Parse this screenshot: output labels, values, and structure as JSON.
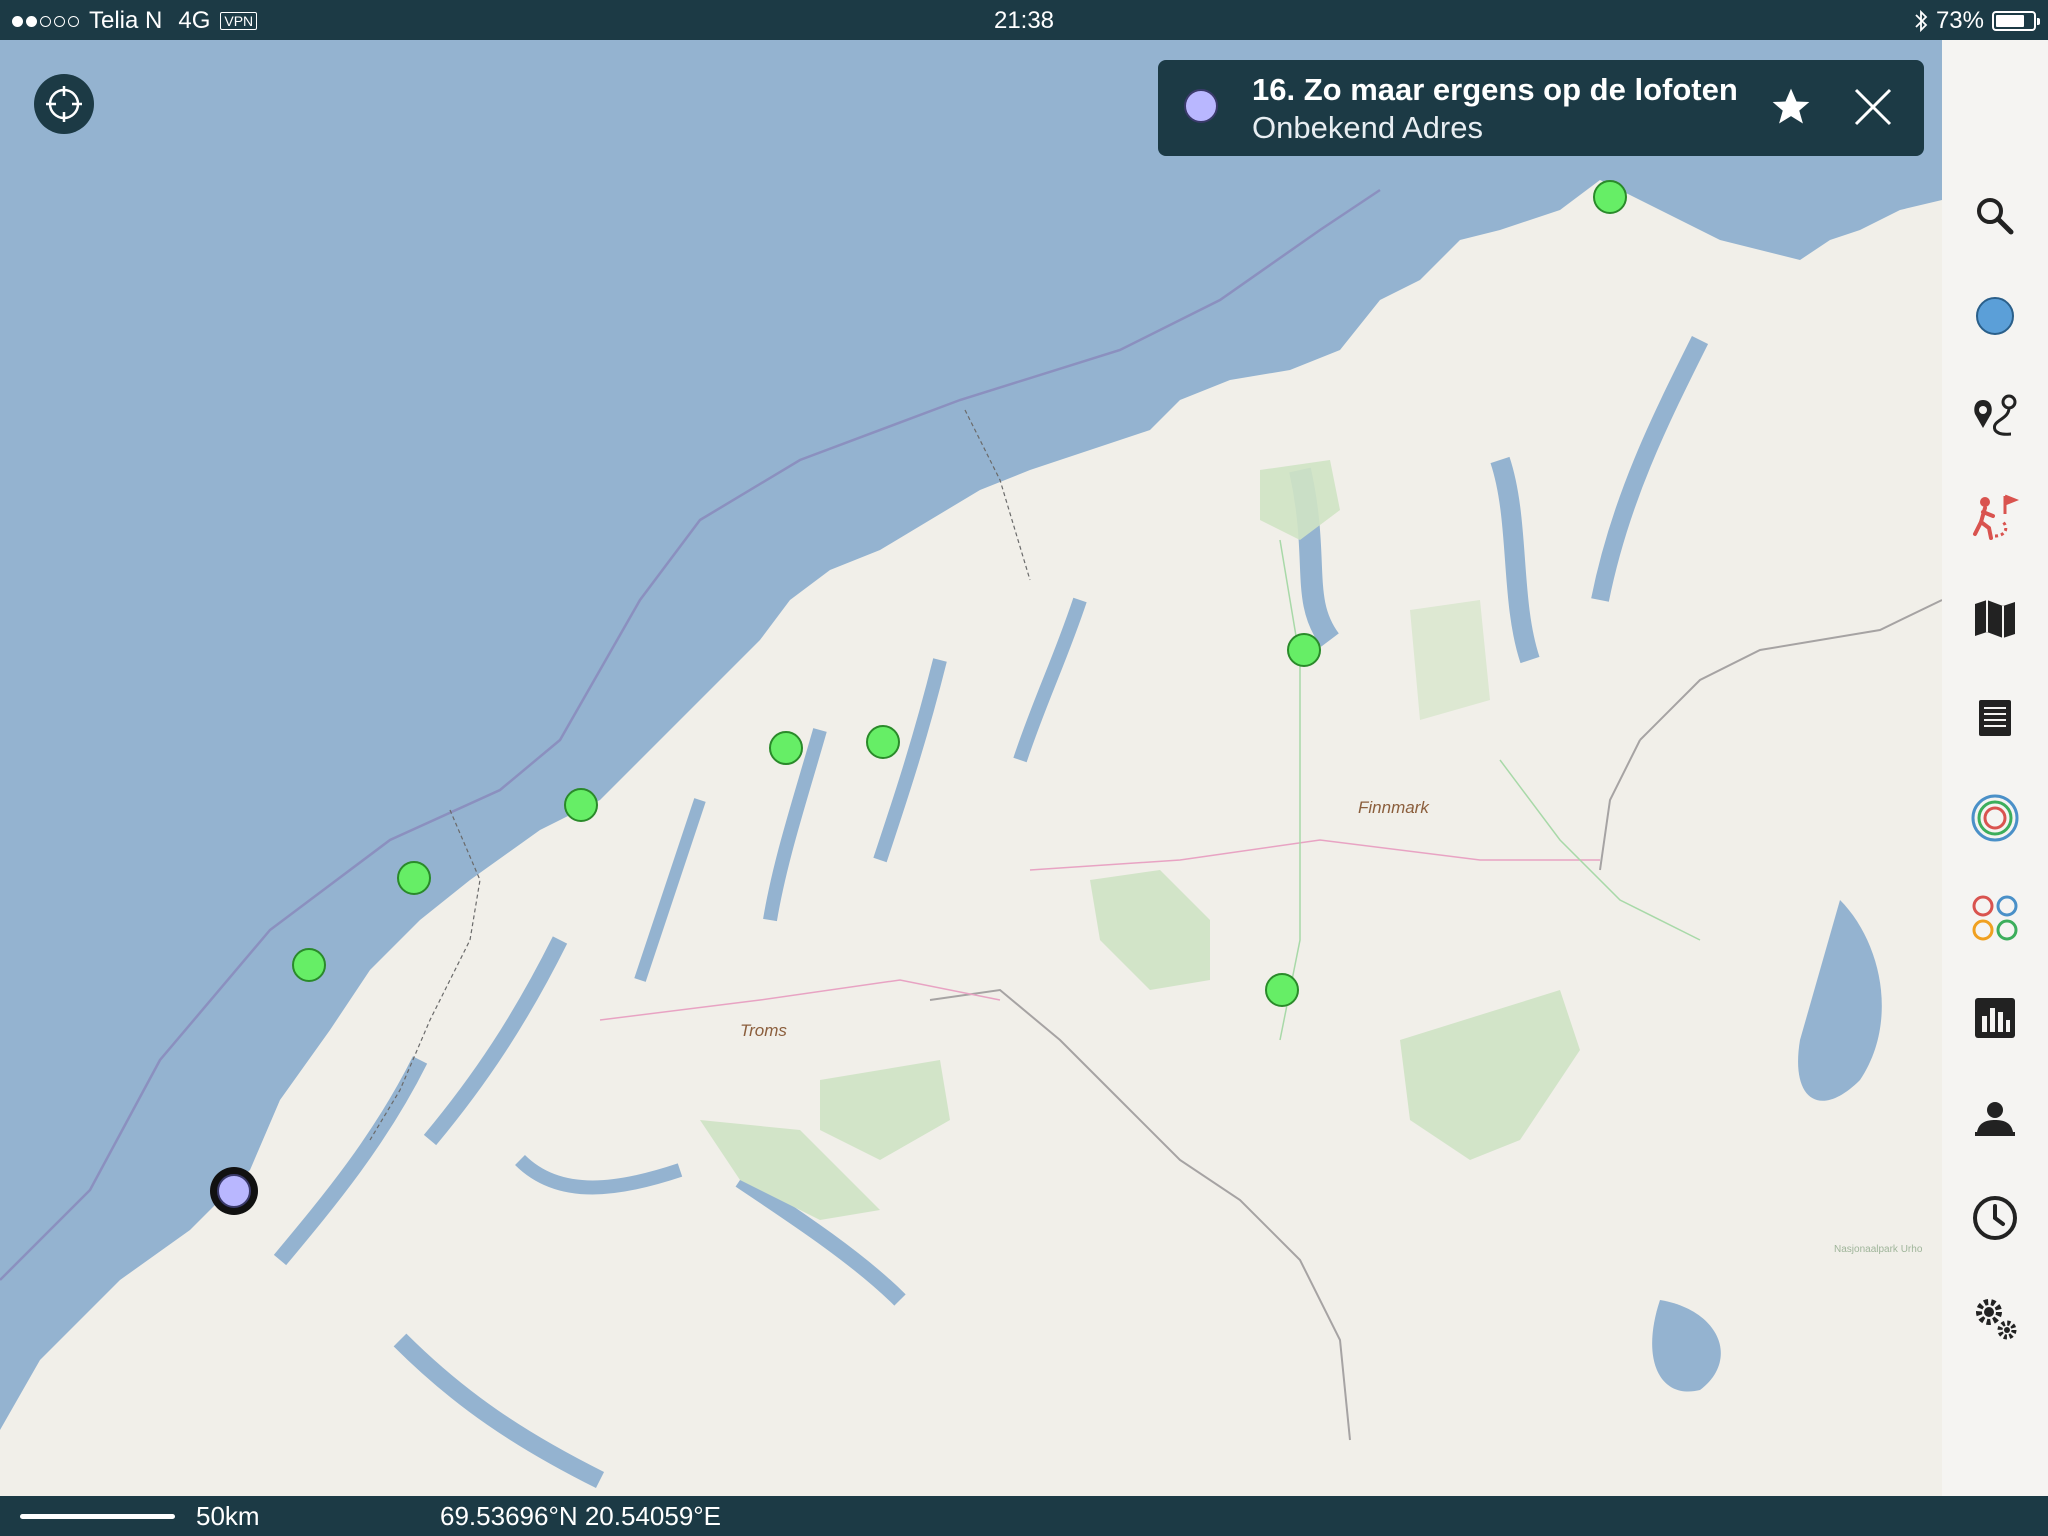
{
  "status": {
    "carrier": "Telia N",
    "network": "4G",
    "vpn": "VPN",
    "time": "21:38",
    "battery": "73%",
    "battery_level": 0.73
  },
  "popup": {
    "title": "16. Zo maar ergens op de lofoten",
    "subtitle": "Onbekend Adres",
    "marker_color": "#b9b7ff"
  },
  "map": {
    "labels": [
      "Finnmark",
      "Troms",
      "Nasjonaalpark Urho"
    ],
    "green_marker_color": "#66ee66",
    "selected_marker_color": "#b9b7ff"
  },
  "sidebar": {
    "items": [
      {
        "icon": "search-icon"
      },
      {
        "icon": "blue-dot-icon"
      },
      {
        "icon": "route-icon"
      },
      {
        "icon": "hike-icon"
      },
      {
        "icon": "map-icon"
      },
      {
        "icon": "list-icon"
      },
      {
        "icon": "target-rings-icon"
      },
      {
        "icon": "colored-circles-icon"
      },
      {
        "icon": "chart-icon"
      },
      {
        "icon": "users-icon"
      },
      {
        "icon": "clock-icon"
      },
      {
        "icon": "settings-icon"
      }
    ]
  },
  "bottom": {
    "scale": "50km",
    "coordinates": "69.53696°N 20.54059°E"
  }
}
